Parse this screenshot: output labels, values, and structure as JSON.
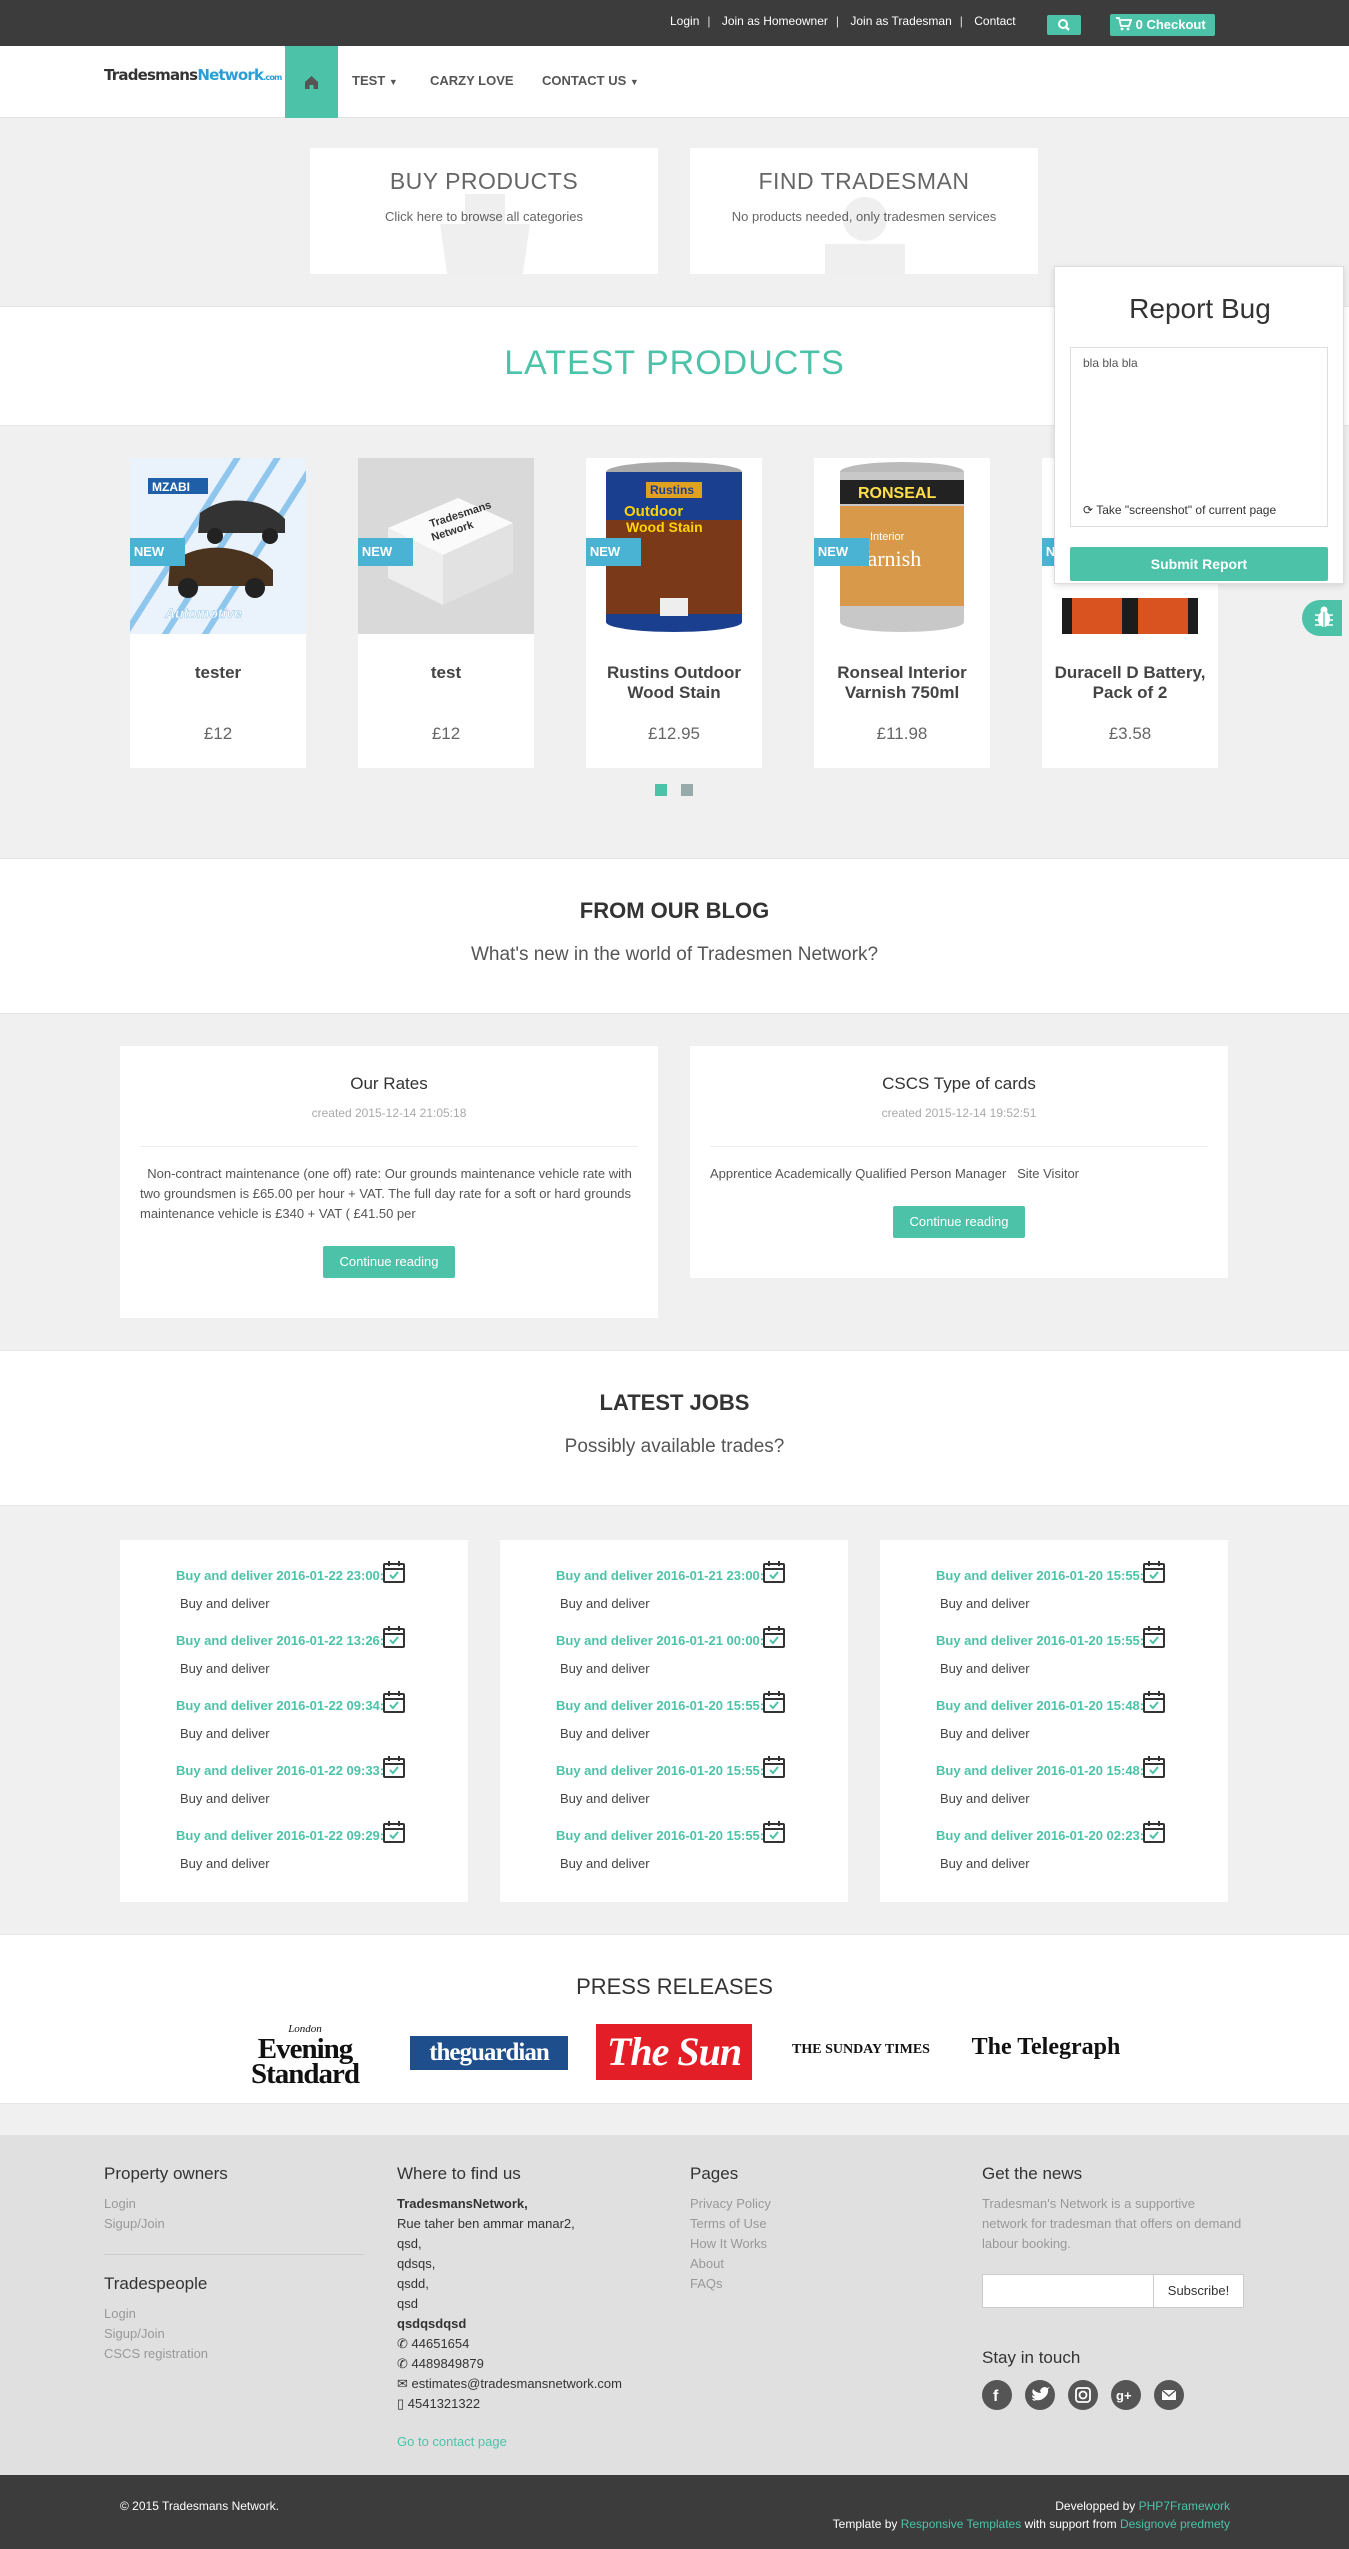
{
  "topbar": {
    "links": [
      "Login",
      "Join as Homeowner",
      "Join as Tradesman",
      "Contact"
    ],
    "cart_label": "0 Checkout"
  },
  "nav": {
    "logo_main": "Tradesmans",
    "logo_accent": "Network",
    "logo_suffix": ".com",
    "items": [
      {
        "label": "TEST",
        "dropdown": true
      },
      {
        "label": "CARZY LOVE",
        "dropdown": false
      },
      {
        "label": "CONTACT US",
        "dropdown": true
      }
    ]
  },
  "features": [
    {
      "title": "BUY PRODUCTS",
      "text": "Click here to browse all categories"
    },
    {
      "title": "FIND TRADESMAN",
      "text": "No products needed, only tradesmen services"
    }
  ],
  "latest_products": {
    "title": "LATEST PRODUCTS",
    "badge": "NEW",
    "items": [
      {
        "name": "tester",
        "price": "£12",
        "image": "car-dealer-logo"
      },
      {
        "name": "test",
        "price": "£12",
        "image": "tradesmans-network-box"
      },
      {
        "name": "Rustins Outdoor Wood Stain",
        "price": "£12.95",
        "image": "paint-can-rustins"
      },
      {
        "name": "Ronseal Interior Varnish 750ml",
        "price": "£11.98",
        "image": "paint-can-ronseal"
      },
      {
        "name": "Duracell D Battery, Pack of 2",
        "price": "£3.58",
        "image": "battery-pack"
      }
    ],
    "active_page": 1,
    "pages": 2
  },
  "report_bug": {
    "title": "Report Bug",
    "textarea_value": "bla bla bla",
    "screenshot_label": "Take \"screenshot\" of current page",
    "submit_label": "Submit Report"
  },
  "blog": {
    "title": "FROM OUR BLOG",
    "subtitle": "What's new in the world of Tradesmen Network?",
    "posts": [
      {
        "title": "Our Rates",
        "created": "created 2015-12-14 21:05:18",
        "excerpt": "  Non-contract maintenance (one off) rate: Our grounds maintenance vehicle rate with two groundsmen is £65.00 per hour + VAT. The full day rate for a soft or hard grounds maintenance vehicle is £340 + VAT ( £41.50 per",
        "button": "Continue reading"
      },
      {
        "title": "CSCS Type of cards",
        "created": "created 2015-12-14 19:52:51",
        "excerpt": "Apprentice Academically Qualified Person Manager   Site Visitor",
        "button": "Continue reading"
      }
    ]
  },
  "jobs": {
    "title": "LATEST JOBS",
    "subtitle": "Possibly available trades?",
    "columns": [
      [
        {
          "title": "Buy and deliver 2016-01-22 23:00:",
          "desc": "Buy and deliver"
        },
        {
          "title": "Buy and deliver 2016-01-22 13:26:",
          "desc": "Buy and deliver"
        },
        {
          "title": "Buy and deliver 2016-01-22 09:34:",
          "desc": "Buy and deliver"
        },
        {
          "title": "Buy and deliver 2016-01-22 09:33:",
          "desc": "Buy and deliver"
        },
        {
          "title": "Buy and deliver 2016-01-22 09:29:",
          "desc": "Buy and deliver"
        }
      ],
      [
        {
          "title": "Buy and deliver 2016-01-21 23:00:",
          "desc": "Buy and deliver"
        },
        {
          "title": "Buy and deliver 2016-01-21 00:00:",
          "desc": "Buy and deliver"
        },
        {
          "title": "Buy and deliver 2016-01-20 15:55:",
          "desc": "Buy and deliver"
        },
        {
          "title": "Buy and deliver 2016-01-20 15:55:",
          "desc": "Buy and deliver"
        },
        {
          "title": "Buy and deliver 2016-01-20 15:55:",
          "desc": "Buy and deliver"
        }
      ],
      [
        {
          "title": "Buy and deliver 2016-01-20 15:55:",
          "desc": "Buy and deliver"
        },
        {
          "title": "Buy and deliver 2016-01-20 15:55:",
          "desc": "Buy and deliver"
        },
        {
          "title": "Buy and deliver 2016-01-20 15:48:",
          "desc": "Buy and deliver"
        },
        {
          "title": "Buy and deliver 2016-01-20 15:48:",
          "desc": "Buy and deliver"
        },
        {
          "title": "Buy and deliver 2016-01-20 02:23:",
          "desc": "Buy and deliver"
        }
      ]
    ]
  },
  "press": {
    "title": "PRESS RELEASES",
    "logos": [
      {
        "top": "London",
        "main": "Evening",
        "sub": "Standard"
      },
      {
        "main": "theguardian"
      },
      {
        "main": "The Sun"
      },
      {
        "main": "THE SUNDAY TIMES"
      },
      {
        "main": "The Telegraph"
      }
    ]
  },
  "footer": {
    "owners_title": "Property owners",
    "owners_links": [
      "Login",
      "Sigup/Join"
    ],
    "trades_title": "Tradespeople",
    "trades_links": [
      "Login",
      "Sigup/Join",
      "CSCS registration"
    ],
    "where_title": "Where to find us",
    "address_name": "TradesmansNetwork,",
    "address_lines": [
      "Rue taher ben ammar manar2,",
      "qsd,",
      "qdsqs,",
      "qsdd,",
      "qsd"
    ],
    "address_bold": "qsdqsdqsd",
    "phone1": "44651654",
    "phone2": "4489849879",
    "email": "estimates@tradesmansnetwork.com",
    "mobile": "4541321322",
    "contact_link": "Go to contact page",
    "pages_title": "Pages",
    "pages_links": [
      "Privacy Policy",
      "Terms of Use",
      "How It Works",
      "About",
      "FAQs"
    ],
    "news_title": "Get the news",
    "news_text": "Tradesman's Network is a supportive network for tradesman that offers on demand labour booking.",
    "email_placeholder": "",
    "subscribe_label": "Subscribe!",
    "stay_title": "Stay in touch",
    "socials": [
      "facebook-icon",
      "twitter-icon",
      "instagram-icon",
      "google-plus-icon",
      "email-icon"
    ]
  },
  "bottom": {
    "copyright": "© 2015 Tradesmans Network.",
    "dev_prefix": "Developped by ",
    "dev_link": "PHP7Framework",
    "tpl_prefix": "Template by ",
    "tpl_link": "Responsive Templates",
    "tpl_mid": " with support from ",
    "tpl_link2": "Designové predmety"
  },
  "colors": {
    "accent": "#4cc3a8",
    "topbar": "#3c3c3c",
    "ribbon": "#4ab3d4"
  }
}
